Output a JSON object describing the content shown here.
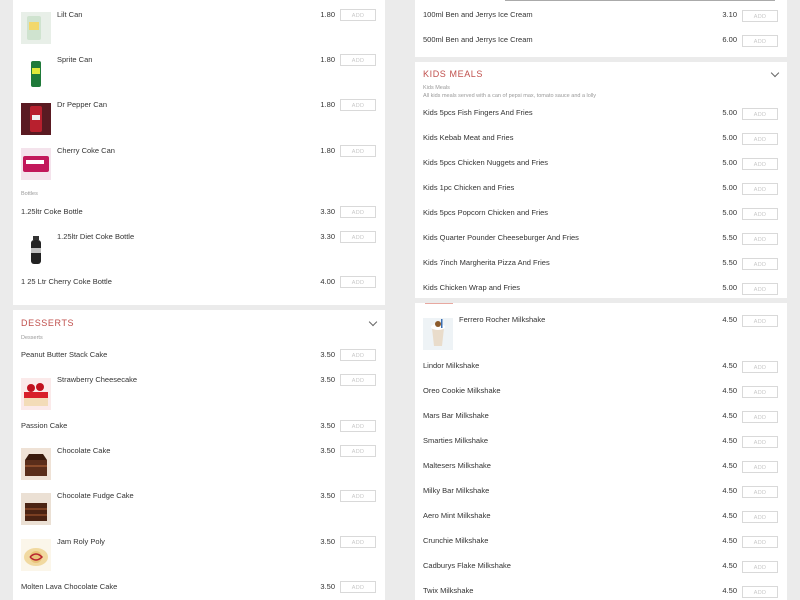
{
  "add_label": "ADD",
  "left_top": {
    "items": [
      {
        "name": "Lilt Can",
        "price": "1.80"
      },
      {
        "name": "Sprite Can",
        "price": "1.80"
      },
      {
        "name": "Dr Pepper Can",
        "price": "1.80"
      },
      {
        "name": "Cherry Coke Can",
        "price": "1.80"
      }
    ],
    "sub_label": "Bottles",
    "bottles": [
      {
        "name": "1.25ltr Coke Bottle",
        "price": "3.30"
      },
      {
        "name": "1.25ltr Diet Coke Bottle",
        "price": "3.30"
      },
      {
        "name": "1 25 Ltr Cherry Coke Bottle",
        "price": "4.00"
      }
    ]
  },
  "desserts": {
    "title": "DESSERTS",
    "sub_label": "Desserts",
    "items": [
      {
        "name": "Peanut Butter Stack Cake",
        "price": "3.50"
      },
      {
        "name": "Strawberry Cheesecake",
        "price": "3.50"
      },
      {
        "name": "Passion Cake",
        "price": "3.50"
      },
      {
        "name": "Chocolate Cake",
        "price": "3.50"
      },
      {
        "name": "Chocolate Fudge Cake",
        "price": "3.50"
      },
      {
        "name": "Jam Roly Poly",
        "price": "3.50"
      },
      {
        "name": "Molten Lava Chocolate Cake",
        "price": "3.50"
      }
    ]
  },
  "right_top": {
    "items": [
      {
        "name": "100ml Ben and Jerrys Ice Cream",
        "price": "3.10"
      },
      {
        "name": "500ml Ben and Jerrys Ice Cream",
        "price": "6.00"
      }
    ]
  },
  "kids_meals": {
    "title": "KIDS MEALS",
    "sub_label": "Kids Meals",
    "sub_desc": "All kids meals served with a can of pepsi max, tomato sauce and a lolly",
    "items": [
      {
        "name": "Kids 5pcs Fish Fingers And Fries",
        "price": "5.00"
      },
      {
        "name": "Kids Kebab Meat and Fries",
        "price": "5.00"
      },
      {
        "name": "Kids 5pcs Chicken Nuggets and Fries",
        "price": "5.00"
      },
      {
        "name": "Kids 1pc Chicken and Fries",
        "price": "5.00"
      },
      {
        "name": "Kids 5pcs Popcorn Chicken and Fries",
        "price": "5.00"
      },
      {
        "name": "Kids Quarter Pounder Cheeseburger And Fries",
        "price": "5.50"
      },
      {
        "name": "Kids 7inch Margherita Pizza And Fries",
        "price": "5.50"
      },
      {
        "name": "Kids Chicken Wrap and Fries",
        "price": "5.00"
      }
    ]
  },
  "milkshakes": {
    "items": [
      {
        "name": "Ferrero Rocher Milkshake",
        "price": "4.50"
      },
      {
        "name": "Lindor Milkshake",
        "price": "4.50"
      },
      {
        "name": "Oreo Cookie Milkshake",
        "price": "4.50"
      },
      {
        "name": "Mars Bar Milkshake",
        "price": "4.50"
      },
      {
        "name": "Smarties Milkshake",
        "price": "4.50"
      },
      {
        "name": "Maltesers Milkshake",
        "price": "4.50"
      },
      {
        "name": "Milky Bar Milkshake",
        "price": "4.50"
      },
      {
        "name": "Aero Mint Milkshake",
        "price": "4.50"
      },
      {
        "name": "Crunchie Milkshake",
        "price": "4.50"
      },
      {
        "name": "Cadburys Flake Milkshake",
        "price": "4.50"
      },
      {
        "name": "Twix Milkshake",
        "price": "4.50"
      }
    ]
  },
  "colors": {
    "accent": "#c0504d",
    "background": "#ebebeb"
  }
}
